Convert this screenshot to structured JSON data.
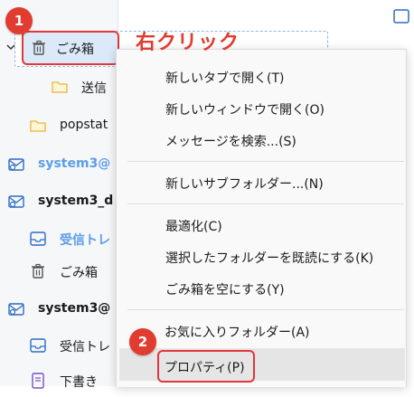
{
  "annotation": {
    "badge1": "1",
    "badge2": "2",
    "right_click": "右クリック"
  },
  "folders": [
    {
      "label": "ごみ箱",
      "icon": "trash-icon",
      "style": "normal"
    },
    {
      "label": "送信",
      "icon": "folder-icon",
      "style": "normal"
    },
    {
      "label": "popstat",
      "icon": "folder-icon",
      "style": "normal"
    },
    {
      "label": "system3@",
      "icon": "mail-account-icon",
      "style": "blue"
    },
    {
      "label": "system3_d",
      "icon": "mail-account-icon",
      "style": "bold"
    },
    {
      "label": "受信トレ",
      "icon": "inbox-icon",
      "style": "blue"
    },
    {
      "label": "ごみ箱",
      "icon": "trash-icon",
      "style": "normal"
    },
    {
      "label": "system3@",
      "icon": "mail-account-icon",
      "style": "bold"
    },
    {
      "label": "受信トレ",
      "icon": "inbox-icon",
      "style": "normal"
    },
    {
      "label": "下書き",
      "icon": "drafts-icon",
      "style": "normal"
    }
  ],
  "context_menu": {
    "items": [
      {
        "label": "新しいタブで開く(T)"
      },
      {
        "label": "新しいウィンドウで開く(O)"
      },
      {
        "label": "メッセージを検索...(S)"
      },
      {
        "label": "新しいサブフォルダー...(N)"
      },
      {
        "label": "最適化(C)"
      },
      {
        "label": "選択したフォルダーを既読にする(K)"
      },
      {
        "label": "ごみ箱を空にする(Y)"
      },
      {
        "label": "お気に入りフォルダー(A)"
      },
      {
        "label": "プロパティ(P)"
      }
    ]
  },
  "colors": {
    "accent_red": "#e23b2f",
    "account_blue": "#5b9ee6",
    "selection": "#dbe9f8"
  }
}
